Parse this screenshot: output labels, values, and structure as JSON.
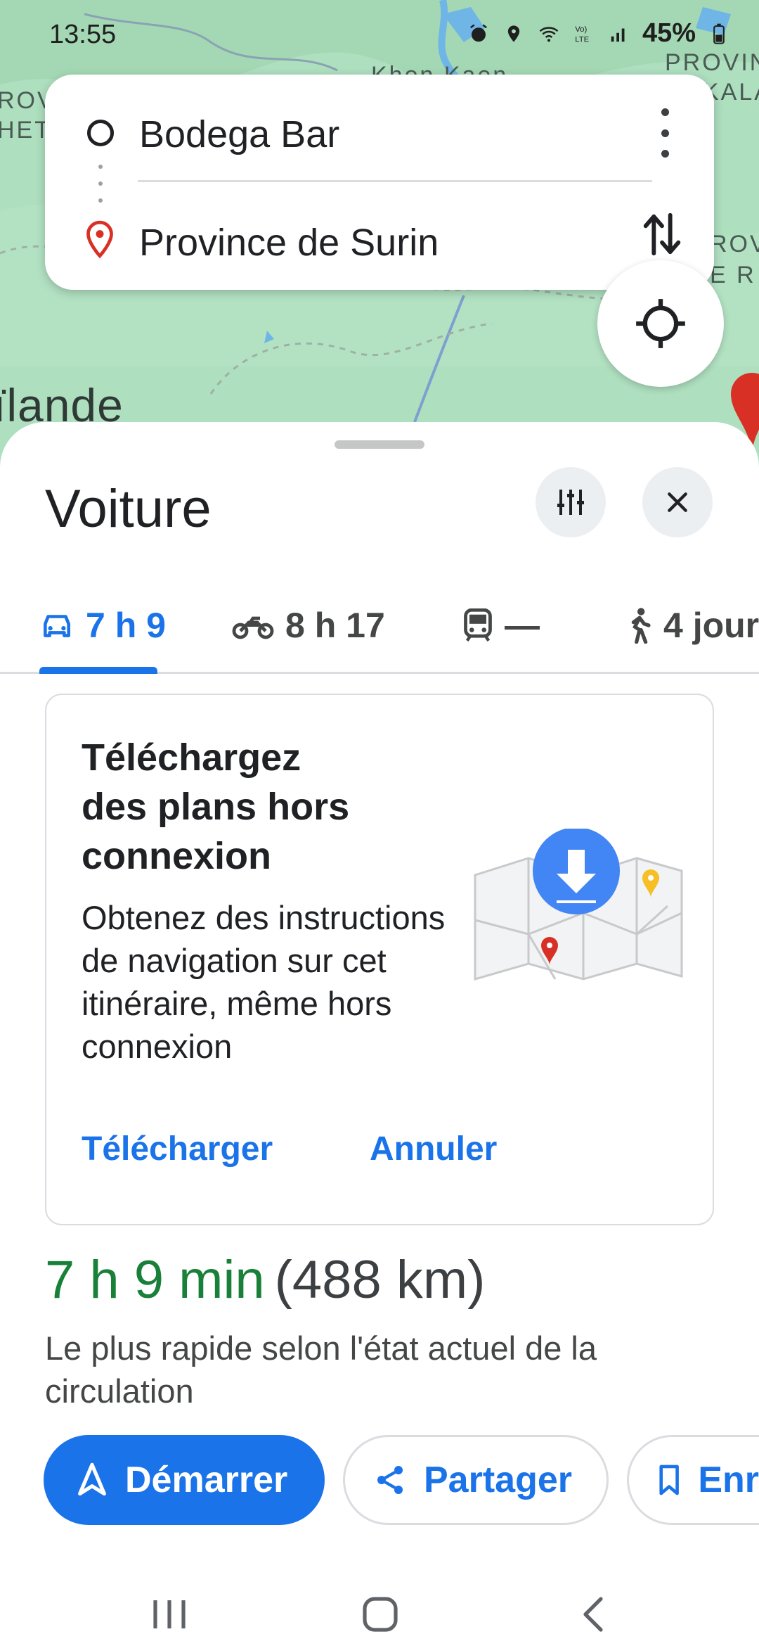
{
  "status_bar": {
    "time": "13:55",
    "battery": "45%"
  },
  "map": {
    "labels": {
      "khon_kaen": "Khon Kaen",
      "province_right": "PROVIN",
      "province_right2": "KALA",
      "prov_left": "ROV",
      "het_left": "HET",
      "prov_right3": "ROV",
      "e_r": "E R",
      "thailand": "ïlande"
    }
  },
  "route": {
    "origin": "Bodega Bar",
    "destination": "Province de Surin"
  },
  "sheet": {
    "title": "Voiture",
    "tabs": [
      {
        "label": "7 h 9",
        "icon": "car-icon"
      },
      {
        "label": "8 h 17",
        "icon": "motorcycle-icon"
      },
      {
        "label": "—",
        "icon": "transit-icon"
      },
      {
        "label": "4 jour",
        "icon": "walk-icon"
      }
    ]
  },
  "offline_card": {
    "title": "Téléchargez des plans hors connexion",
    "body": "Obtenez des instructions de navigation sur cet itinéraire, même hors connexion",
    "download": "Télécharger",
    "cancel": "Annuler"
  },
  "summary": {
    "duration": "7 h 9 min",
    "distance": "(488 km)",
    "description": "Le plus rapide selon l'état actuel de la circulation"
  },
  "actions": {
    "start": "Démarrer",
    "share": "Partager",
    "save": "Enr"
  },
  "colors": {
    "accent": "#1a73e8",
    "route_time": "#188038",
    "pin_red": "#d93025",
    "map_green": "#aedfbf"
  }
}
